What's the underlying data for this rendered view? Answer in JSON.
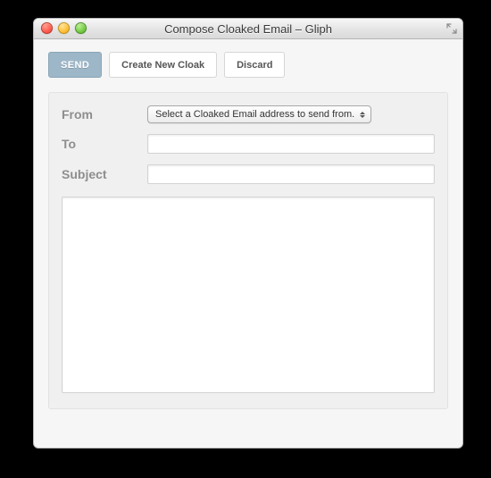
{
  "window": {
    "title": "Compose Cloaked Email – Gliph"
  },
  "toolbar": {
    "send_label": "SEND",
    "create_cloak_label": "Create New Cloak",
    "discard_label": "Discard"
  },
  "fields": {
    "from_label": "From",
    "from_select_placeholder": "Select a Cloaked Email address to send from.",
    "from_select_value": "",
    "to_label": "To",
    "to_value": "",
    "subject_label": "Subject",
    "subject_value": "",
    "body_value": ""
  }
}
